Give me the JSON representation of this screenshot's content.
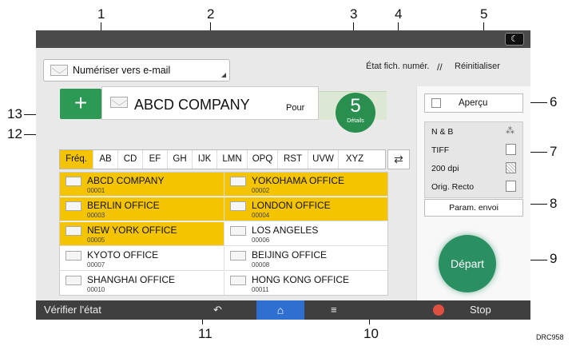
{
  "header": {
    "scan_mode": "Numériser vers e-mail",
    "etat_fichier": "État fich. numér.",
    "reinitialiser": "Réinitialiser"
  },
  "destination": {
    "name": "ABCD COMPANY",
    "pour": "Pour",
    "count": "5",
    "details": "Détails"
  },
  "right_panel": {
    "apercu": "Aperçu",
    "settings": [
      "N & B",
      "TIFF",
      "200 dpi",
      "Orig. Recto"
    ],
    "param_envoi": "Param. envoi",
    "depart": "Départ"
  },
  "tabs": [
    "Fréq.",
    "AB",
    "CD",
    "EF",
    "GH",
    "IJK",
    "LMN",
    "OPQ",
    "RST",
    "UVW",
    "XYZ"
  ],
  "entries": [
    {
      "name": "ABCD COMPANY",
      "code": "00001",
      "selected": true
    },
    {
      "name": "YOKOHAMA OFFICE",
      "code": "00002",
      "selected": true
    },
    {
      "name": "BERLIN OFFICE",
      "code": "00003",
      "selected": true
    },
    {
      "name": "LONDON OFFICE",
      "code": "00004",
      "selected": true
    },
    {
      "name": "NEW YORK OFFICE",
      "code": "00005",
      "selected": true
    },
    {
      "name": "LOS ANGELES",
      "code": "00006",
      "selected": false
    },
    {
      "name": "KYOTO OFFICE",
      "code": "00007",
      "selected": false
    },
    {
      "name": "BEIJING OFFICE",
      "code": "00008",
      "selected": false
    },
    {
      "name": "SHANGHAI  OFFICE",
      "code": "00010",
      "selected": false
    },
    {
      "name": "HONG KONG OFFICE",
      "code": "00011",
      "selected": false
    }
  ],
  "bottom": {
    "verifier": "Vérifier l'état",
    "stop": "Stop"
  },
  "callouts": [
    "1",
    "2",
    "3",
    "4",
    "5",
    "6",
    "7",
    "8",
    "9",
    "10",
    "11",
    "12",
    "13"
  ],
  "figure_id": "DRC958"
}
